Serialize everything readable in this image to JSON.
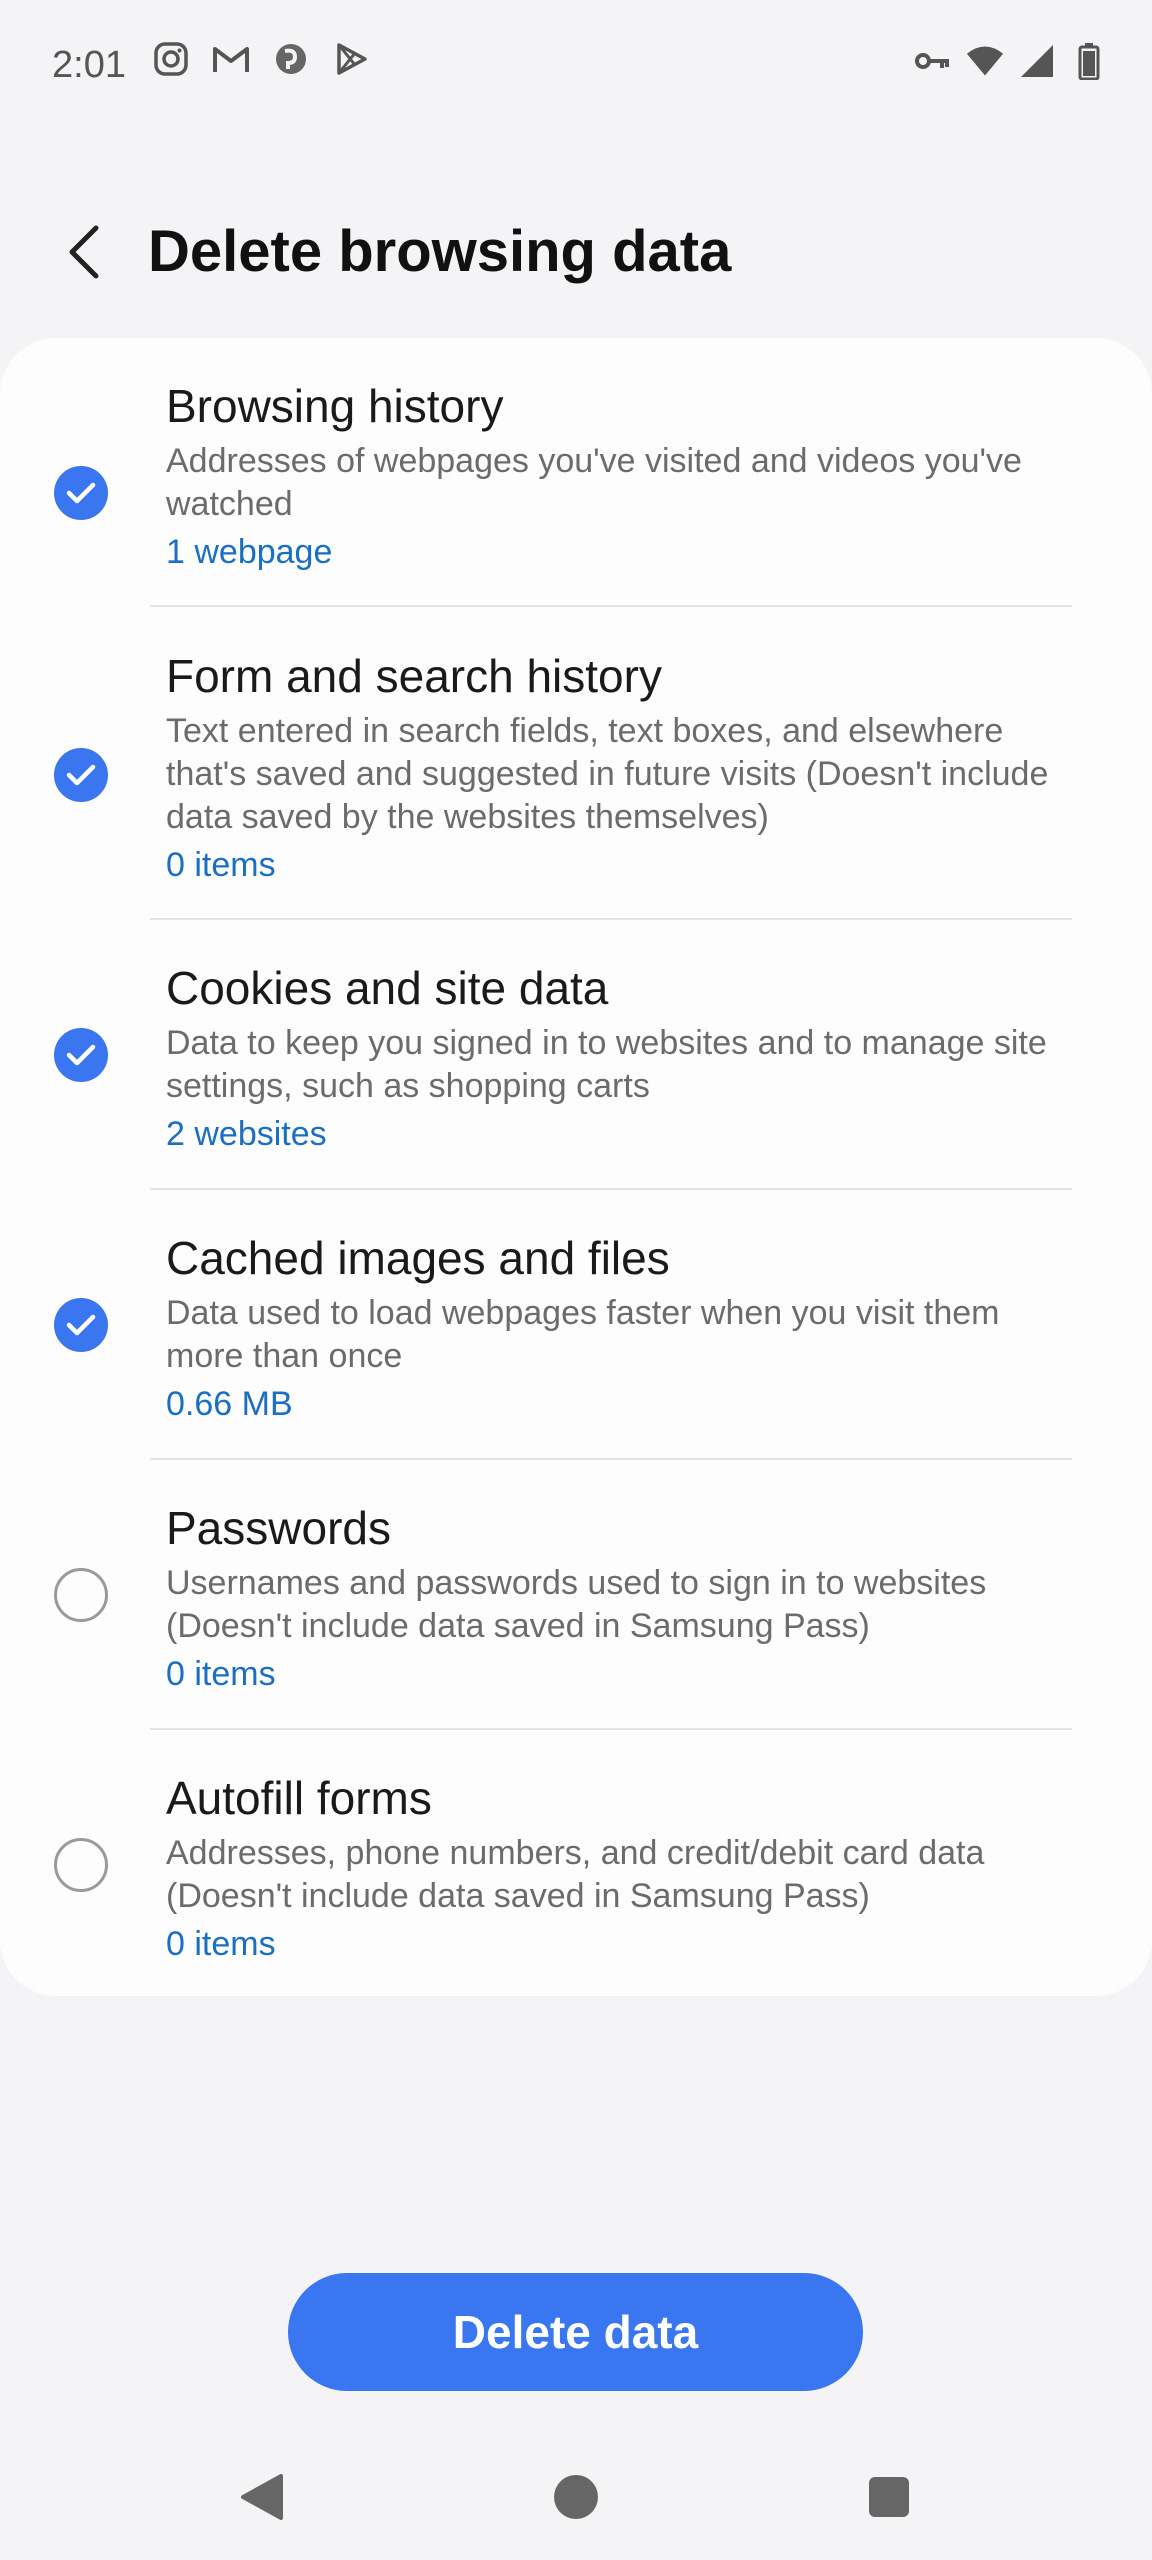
{
  "status_bar": {
    "time": "2:01",
    "left_icons": [
      "instagram-icon",
      "gmail-icon",
      "app-icon",
      "play-store-icon"
    ],
    "right_icons": [
      "vpn-key-icon",
      "wifi-icon",
      "signal-icon",
      "battery-icon"
    ]
  },
  "header": {
    "title": "Delete browsing data"
  },
  "items": [
    {
      "title": "Browsing history",
      "desc": "Addresses of webpages you've visited and videos you've watched",
      "count": "1 webpage",
      "checked": true
    },
    {
      "title": "Form and search history",
      "desc": "Text entered in search fields, text boxes, and elsewhere that's saved and suggested in future visits (Doesn't include data saved by the websites themselves)",
      "count": "0 items",
      "checked": true
    },
    {
      "title": "Cookies and site data",
      "desc": "Data to keep you signed in to websites and to manage site settings, such as shopping carts",
      "count": "2 websites",
      "checked": true
    },
    {
      "title": "Cached images and files",
      "desc": "Data used to load webpages faster when you visit them more than once",
      "count": "0.66 MB",
      "checked": true
    },
    {
      "title": "Passwords",
      "desc": "Usernames and passwords used to sign in to websites (Doesn't include data saved in Samsung Pass)",
      "count": "0 items",
      "checked": false
    },
    {
      "title": "Autofill forms",
      "desc": "Addresses, phone numbers, and credit/debit card data (Doesn't include data saved in Samsung Pass)",
      "count": "0 items",
      "checked": false
    }
  ],
  "actions": {
    "delete_label": "Delete data"
  },
  "colors": {
    "accent": "#3a76f0",
    "link": "#1a6fc2",
    "background": "#f4f4f6",
    "card": "#fdfdfd"
  },
  "nav_bar": {
    "icons": [
      "back-triangle-icon",
      "home-circle-icon",
      "recents-square-icon"
    ]
  }
}
